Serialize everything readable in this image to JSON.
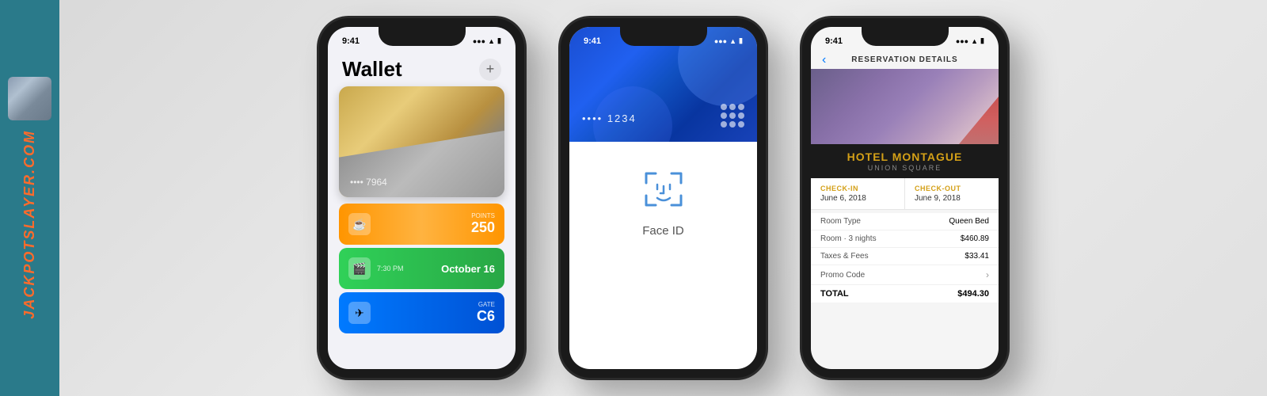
{
  "sidebar": {
    "brand_text": "JACKPOTSLAYER.COM",
    "brand_color": "#ff6b2b"
  },
  "phone1": {
    "status_time": "9:41",
    "title": "Wallet",
    "add_button": "+",
    "card1_number": "•••• 7964",
    "pass1": {
      "icon": "☕",
      "points_label": "POINTS",
      "points_value": "250"
    },
    "pass2": {
      "icon": "🎬",
      "time": "7:30 PM",
      "date": "October 16"
    },
    "pass3": {
      "icon": "✈",
      "gate_label": "GATE",
      "gate_value": "C6"
    }
  },
  "phone2": {
    "status_time": "9:41",
    "card_number": "•••• 1234",
    "face_id_label": "Face ID"
  },
  "phone3": {
    "status_time": "9:41",
    "nav_title": "RESERVATION DETAILS",
    "back_label": "‹",
    "hotel_name": "HOTEL MONTAGUE",
    "hotel_location": "UNION SQUARE",
    "checkin_label": "CHECK-IN",
    "checkin_date": "June 6, 2018",
    "checkout_label": "CHECK-OUT",
    "checkout_date": "June 9, 2018",
    "rows": [
      {
        "label": "Room Type",
        "value": "Queen Bed"
      },
      {
        "label": "Room · 3 nights",
        "value": "$460.89"
      },
      {
        "label": "Taxes & Fees",
        "value": "$33.41"
      },
      {
        "label": "Promo Code",
        "value": "›"
      }
    ],
    "total_label": "TOTAL",
    "total_value": "$494.30"
  }
}
